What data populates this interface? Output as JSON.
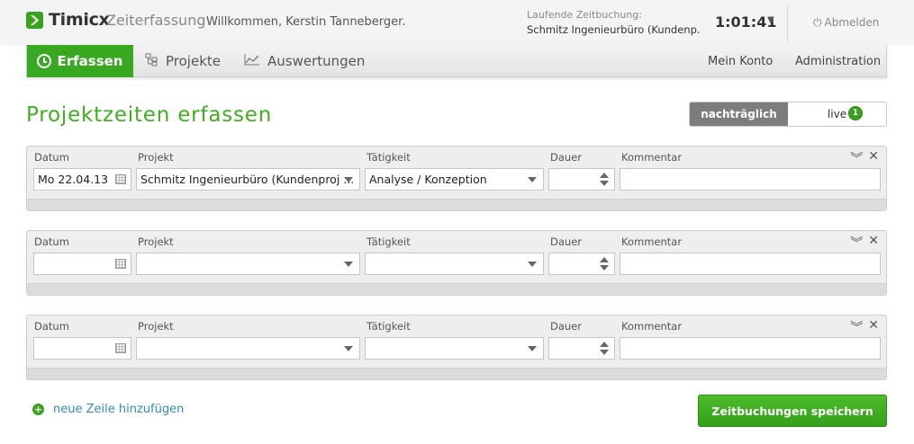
{
  "header": {
    "logo_name": "Timicx",
    "logo_sub": "Zeiterfassung",
    "welcome": "Willkommen, Kerstin Tanneberger.",
    "running_label": "Laufende Zeitbuchung:",
    "running_value": "Schmitz Ingenieurbüro (Kundenp...",
    "timer": "1:01:41",
    "logout": "Abmelden",
    "logo_color": "#3aa31e"
  },
  "nav": {
    "items": [
      {
        "label": "Erfassen",
        "icon": "clock-icon",
        "active": true
      },
      {
        "label": "Projekte",
        "icon": "hierarchy-icon"
      },
      {
        "label": "Auswertungen",
        "icon": "chart-line-icon"
      }
    ],
    "right": [
      "Mein Konto",
      "Administration"
    ],
    "active_color": "#38a820"
  },
  "page": {
    "title": "Projektzeiten erfassen",
    "mode_nachtraeglich": "nachträglich",
    "mode_live": "live",
    "live_badge": "1"
  },
  "columns": {
    "datum": "Datum",
    "projekt": "Projekt",
    "taetigkeit": "Tätigkeit",
    "dauer": "Dauer",
    "kommentar": "Kommentar"
  },
  "rows": [
    {
      "datum": "Mo 22.04.13",
      "projekt": "Schmitz Ingenieurbüro (Kundenproj ...",
      "taetigkeit": "Analyse / Konzeption",
      "dauer": "",
      "kommentar": ""
    },
    {
      "datum": "",
      "projekt": "",
      "taetigkeit": "",
      "dauer": "",
      "kommentar": ""
    },
    {
      "datum": "",
      "projekt": "",
      "taetigkeit": "",
      "dauer": "",
      "kommentar": ""
    }
  ],
  "actions": {
    "add_row": "neue Zeile hinzufügen",
    "save": "Zeitbuchungen speichern"
  }
}
